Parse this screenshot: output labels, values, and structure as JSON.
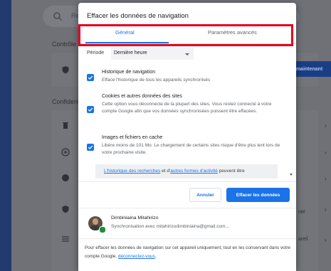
{
  "background": {
    "search_placeholder": "Re",
    "section_control": "Contrôle",
    "section_confidentiality": "Confident",
    "right_button_label": "maintenant",
    "right_text_1": "nté",
    "right_text_2": "areil"
  },
  "dialog": {
    "title": "Effacer les données de navigation",
    "tabs": [
      {
        "label": "Général",
        "active": true
      },
      {
        "label": "Paramètres avancés",
        "active": false
      }
    ],
    "period": {
      "label": "Période",
      "value": "Dernière heure"
    },
    "options": [
      {
        "title": "Historique de navigation",
        "description": "Efface l'historique de tous les appareils synchronisés",
        "checked": true
      },
      {
        "title": "Cookies et autres données des sites",
        "description": "Cette option vous déconnecte de la plupart des sites. Vous restez connecté à votre compte Google afin que vos données synchronisées puissent être effacées.",
        "checked": true
      },
      {
        "title": "Images et fichiers en cache",
        "description": "Libère moins de 101 Mo. Le chargement de certains sites risque d'être plus lent lors de votre prochaine visite.",
        "checked": true
      }
    ],
    "info": {
      "link1": "L'historique des recherches",
      "middle": " et d'",
      "link2": "autres formes d'activité",
      "end": " peuvent être"
    },
    "buttons": {
      "cancel": "Annuler",
      "clear": "Effacer les données"
    },
    "account": {
      "name": "Dimbiniaina Mitahirizo",
      "sync_text": "Synchronisation avec mitahirizodimbiniaina@gmail.com..."
    },
    "footer": {
      "text": "Pour effacer les données de navigation sur cet appareil uniquement, tout en les conservant dans votre compte Google, ",
      "link": "déconnectez-vous",
      "end": "."
    }
  },
  "colors": {
    "accent": "#1a73e8",
    "highlight": "#e3001b"
  }
}
